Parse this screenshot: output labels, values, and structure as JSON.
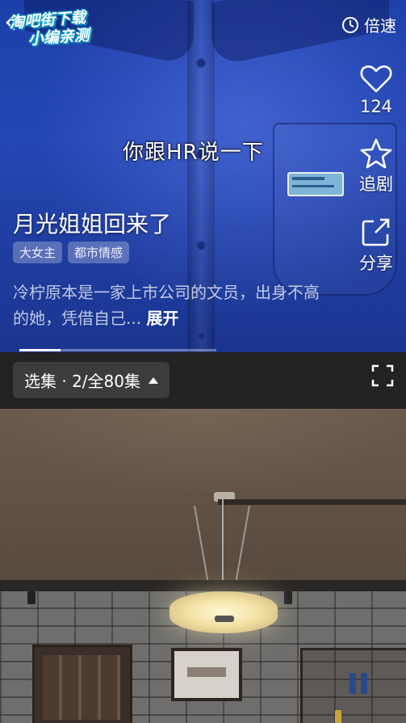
{
  "watermark": {
    "line1": "淘吧街下载",
    "line2": "小编亲测"
  },
  "top_bar": {
    "speed_label": "倍速"
  },
  "actions": {
    "like_count": "124",
    "follow_label": "追剧",
    "share_label": "分享"
  },
  "video": {
    "subtitle": "你跟HR说一下",
    "title": "月光姐姐回来了",
    "tags": [
      "大女主",
      "都市情感"
    ],
    "description": "冷柠原本是一家上市公司的文员，出身不高的她，凭借自己...",
    "expand_label": "展开",
    "progress_fraction": 0.21
  },
  "episode": {
    "selector_label": "选集 · 2/全80集"
  },
  "icons": {
    "back": "chevron-left-icon",
    "speed": "timer-icon",
    "like": "heart-icon",
    "follow": "star-icon",
    "share": "share-icon",
    "fullscreen": "fullscreen-icon",
    "caret": "caret-up-icon"
  },
  "colors": {
    "top_video_bg": "#2446b3",
    "episode_bar_bg": "#222222",
    "selector_bg": "#3c3c3c"
  }
}
